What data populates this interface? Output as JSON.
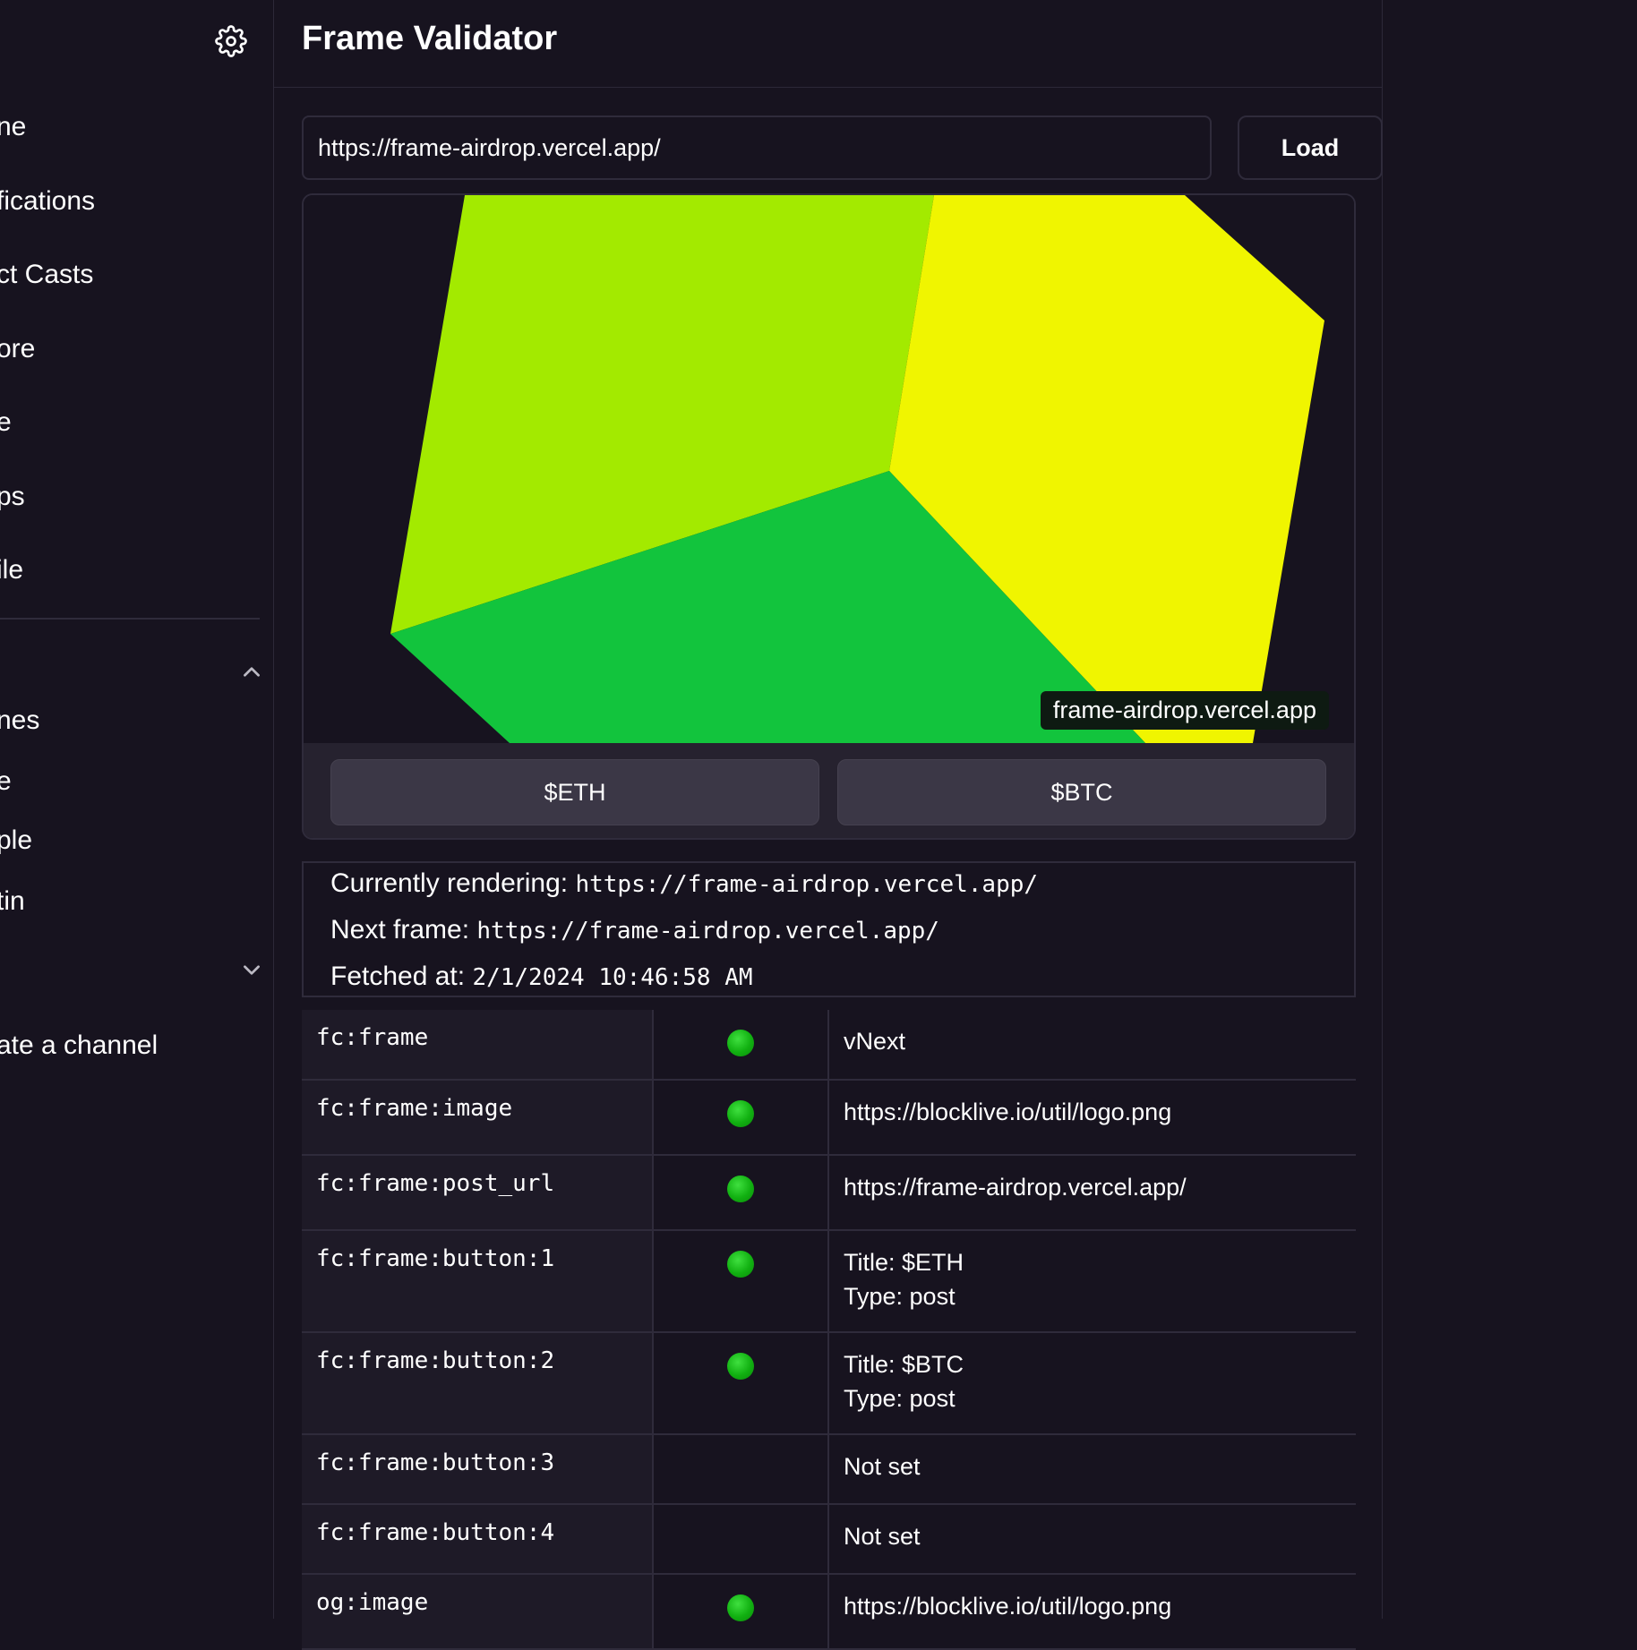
{
  "sidebar": {
    "items": [
      {
        "label": "ne"
      },
      {
        "label": "fications"
      },
      {
        "label": "ct Casts"
      },
      {
        "label": "ore"
      },
      {
        "label": "e"
      },
      {
        "label": "ps"
      },
      {
        "label": "ile"
      }
    ],
    "section_items": [
      {
        "label": "nes"
      },
      {
        "label": "e"
      },
      {
        "label": "ple"
      },
      {
        "label": "tin"
      }
    ],
    "create_channel": "ate a channel"
  },
  "header": {
    "title": "Frame Validator"
  },
  "url_bar": {
    "value": "https://frame-airdrop.vercel.app/",
    "load_label": "Load"
  },
  "frame": {
    "domain_badge": "frame-airdrop.vercel.app",
    "buttons": [
      {
        "label": "$ETH"
      },
      {
        "label": "$BTC"
      }
    ],
    "colors": {
      "face_left": "#a3ea00",
      "face_right": "#f0f500",
      "face_bottom": "#12c43d"
    }
  },
  "info": {
    "currently_label": "Currently rendering:",
    "currently_value": "https://frame-airdrop.vercel.app/",
    "next_label": "Next frame:",
    "next_value": "https://frame-airdrop.vercel.app/",
    "fetched_label": "Fetched at:",
    "fetched_value": "2/1/2024 10:46:58 AM"
  },
  "table": {
    "rows": [
      {
        "key": "fc:frame",
        "ok": true,
        "value": "vNext"
      },
      {
        "key": "fc:frame:image",
        "ok": true,
        "value": "https://blocklive.io/util/logo.png"
      },
      {
        "key": "fc:frame:post_url",
        "ok": true,
        "value": "https://frame-airdrop.vercel.app/"
      },
      {
        "key": "fc:frame:button:1",
        "ok": true,
        "value": "Title: $ETH",
        "value2": "Type: post"
      },
      {
        "key": "fc:frame:button:2",
        "ok": true,
        "value": "Title: $BTC",
        "value2": "Type: post"
      },
      {
        "key": "fc:frame:button:3",
        "ok": false,
        "value": "Not set"
      },
      {
        "key": "fc:frame:button:4",
        "ok": false,
        "value": "Not set"
      },
      {
        "key": "og:image",
        "ok": true,
        "value": "https://blocklive.io/util/logo.png"
      }
    ],
    "status_color": "#11b011"
  }
}
